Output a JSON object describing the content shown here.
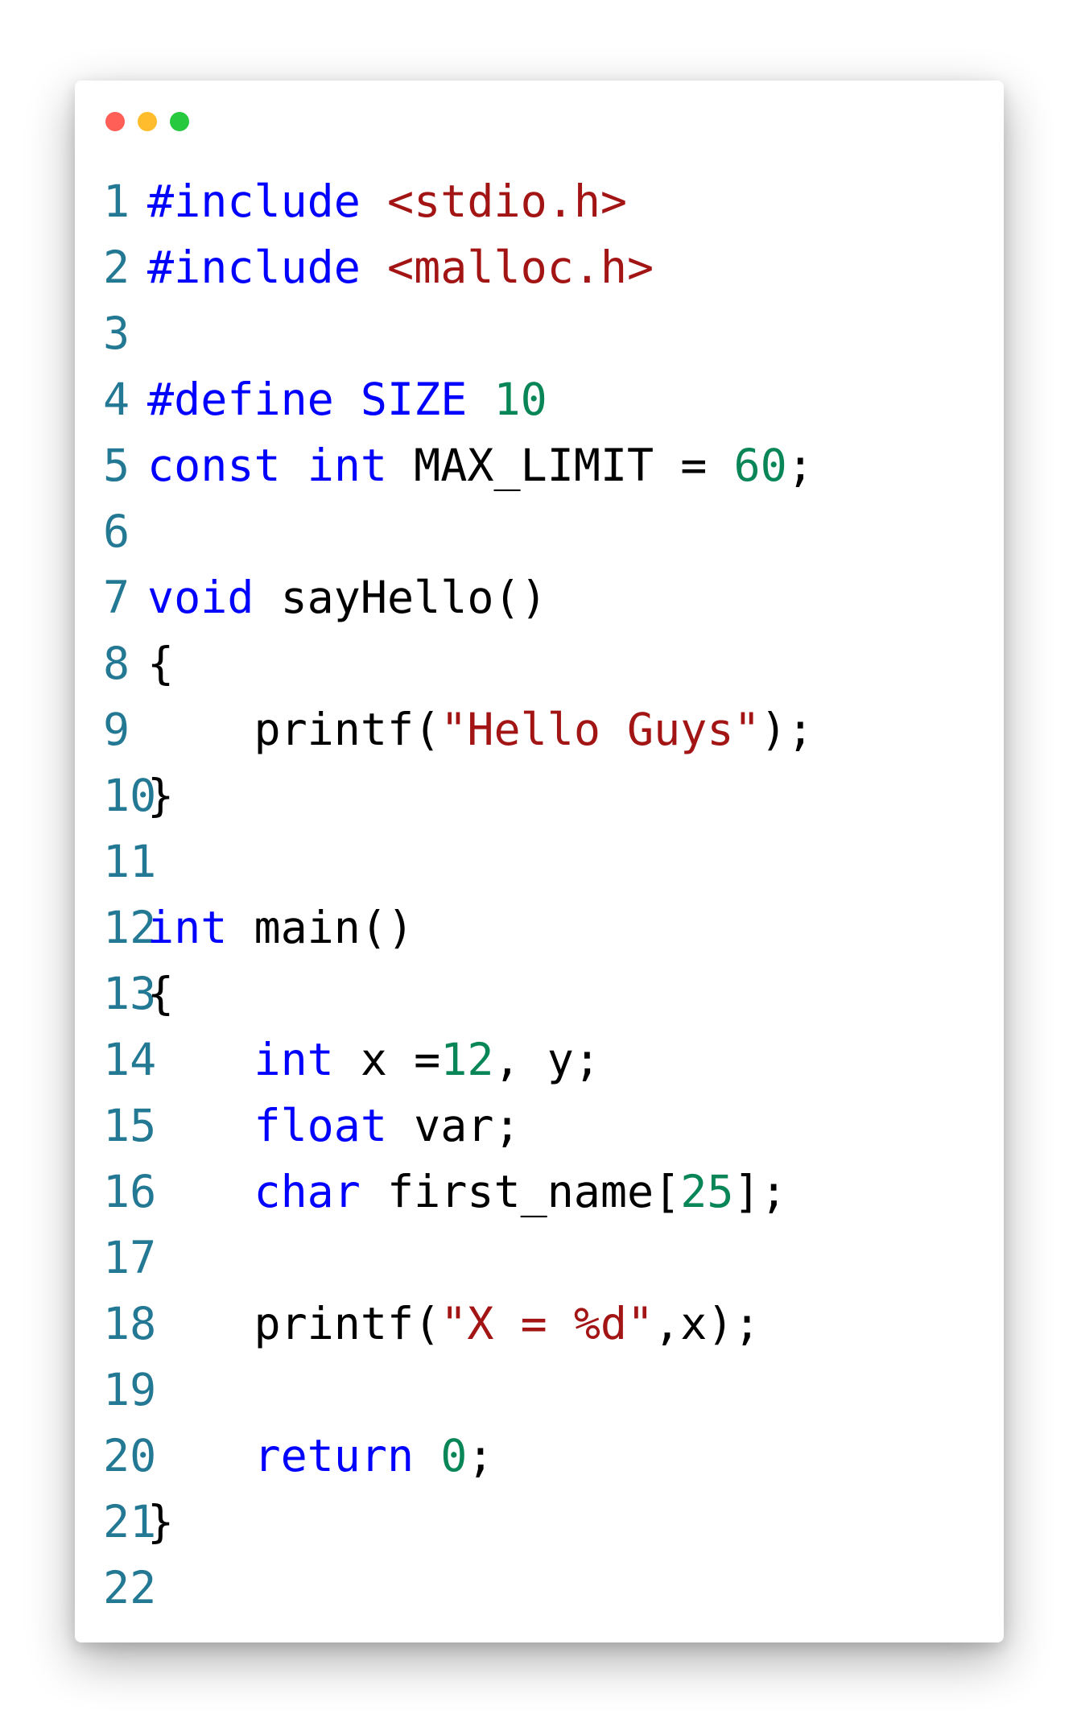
{
  "window": {
    "traffic_lights": [
      {
        "name": "close",
        "color": "#ff5f56"
      },
      {
        "name": "minimize",
        "color": "#ffbd2e"
      },
      {
        "name": "zoom",
        "color": "#27c93f"
      }
    ]
  },
  "colors": {
    "line_number": "#237893",
    "keyword": "#0000ff",
    "string": "#a31515",
    "number": "#098658",
    "text": "#000000"
  },
  "code": {
    "language": "c",
    "lines": [
      {
        "n": "1",
        "tokens": [
          {
            "t": "kw",
            "v": "#include"
          },
          {
            "t": "txt",
            "v": " "
          },
          {
            "t": "str",
            "v": "<stdio.h>"
          }
        ]
      },
      {
        "n": "2",
        "tokens": [
          {
            "t": "kw",
            "v": "#include"
          },
          {
            "t": "txt",
            "v": " "
          },
          {
            "t": "str",
            "v": "<malloc.h>"
          }
        ]
      },
      {
        "n": "3",
        "tokens": []
      },
      {
        "n": "4",
        "tokens": [
          {
            "t": "kw",
            "v": "#define"
          },
          {
            "t": "txt",
            "v": " "
          },
          {
            "t": "kw",
            "v": "SIZE"
          },
          {
            "t": "txt",
            "v": " "
          },
          {
            "t": "num",
            "v": "10"
          }
        ]
      },
      {
        "n": "5",
        "tokens": [
          {
            "t": "kw",
            "v": "const"
          },
          {
            "t": "txt",
            "v": " "
          },
          {
            "t": "kw",
            "v": "int"
          },
          {
            "t": "txt",
            "v": " MAX_LIMIT = "
          },
          {
            "t": "num",
            "v": "60"
          },
          {
            "t": "txt",
            "v": ";"
          }
        ]
      },
      {
        "n": "6",
        "tokens": []
      },
      {
        "n": "7",
        "tokens": [
          {
            "t": "kw",
            "v": "void"
          },
          {
            "t": "txt",
            "v": " sayHello()"
          }
        ]
      },
      {
        "n": "8",
        "tokens": [
          {
            "t": "txt",
            "v": "{"
          }
        ]
      },
      {
        "n": "9",
        "tokens": [
          {
            "t": "txt",
            "v": "    printf("
          },
          {
            "t": "str",
            "v": "\"Hello Guys\""
          },
          {
            "t": "txt",
            "v": ");"
          }
        ]
      },
      {
        "n": "10",
        "tokens": [
          {
            "t": "txt",
            "v": "}"
          }
        ]
      },
      {
        "n": "11",
        "tokens": []
      },
      {
        "n": "12",
        "tokens": [
          {
            "t": "kw",
            "v": "int"
          },
          {
            "t": "txt",
            "v": " main()"
          }
        ]
      },
      {
        "n": "13",
        "tokens": [
          {
            "t": "txt",
            "v": "{"
          }
        ]
      },
      {
        "n": "14",
        "tokens": [
          {
            "t": "txt",
            "v": "    "
          },
          {
            "t": "kw",
            "v": "int"
          },
          {
            "t": "txt",
            "v": " x ="
          },
          {
            "t": "num",
            "v": "12"
          },
          {
            "t": "txt",
            "v": ", y;"
          }
        ]
      },
      {
        "n": "15",
        "tokens": [
          {
            "t": "txt",
            "v": "    "
          },
          {
            "t": "kw",
            "v": "float"
          },
          {
            "t": "txt",
            "v": " var;"
          }
        ]
      },
      {
        "n": "16",
        "tokens": [
          {
            "t": "txt",
            "v": "    "
          },
          {
            "t": "kw",
            "v": "char"
          },
          {
            "t": "txt",
            "v": " first_name["
          },
          {
            "t": "num",
            "v": "25"
          },
          {
            "t": "txt",
            "v": "];"
          }
        ]
      },
      {
        "n": "17",
        "tokens": []
      },
      {
        "n": "18",
        "tokens": [
          {
            "t": "txt",
            "v": "    printf("
          },
          {
            "t": "str",
            "v": "\"X = %d\""
          },
          {
            "t": "txt",
            "v": ",x);"
          }
        ]
      },
      {
        "n": "19",
        "tokens": []
      },
      {
        "n": "20",
        "tokens": [
          {
            "t": "txt",
            "v": "    "
          },
          {
            "t": "kw",
            "v": "return"
          },
          {
            "t": "txt",
            "v": " "
          },
          {
            "t": "num",
            "v": "0"
          },
          {
            "t": "txt",
            "v": ";"
          }
        ]
      },
      {
        "n": "21",
        "tokens": [
          {
            "t": "txt",
            "v": "}"
          }
        ]
      },
      {
        "n": "22",
        "tokens": []
      }
    ]
  }
}
